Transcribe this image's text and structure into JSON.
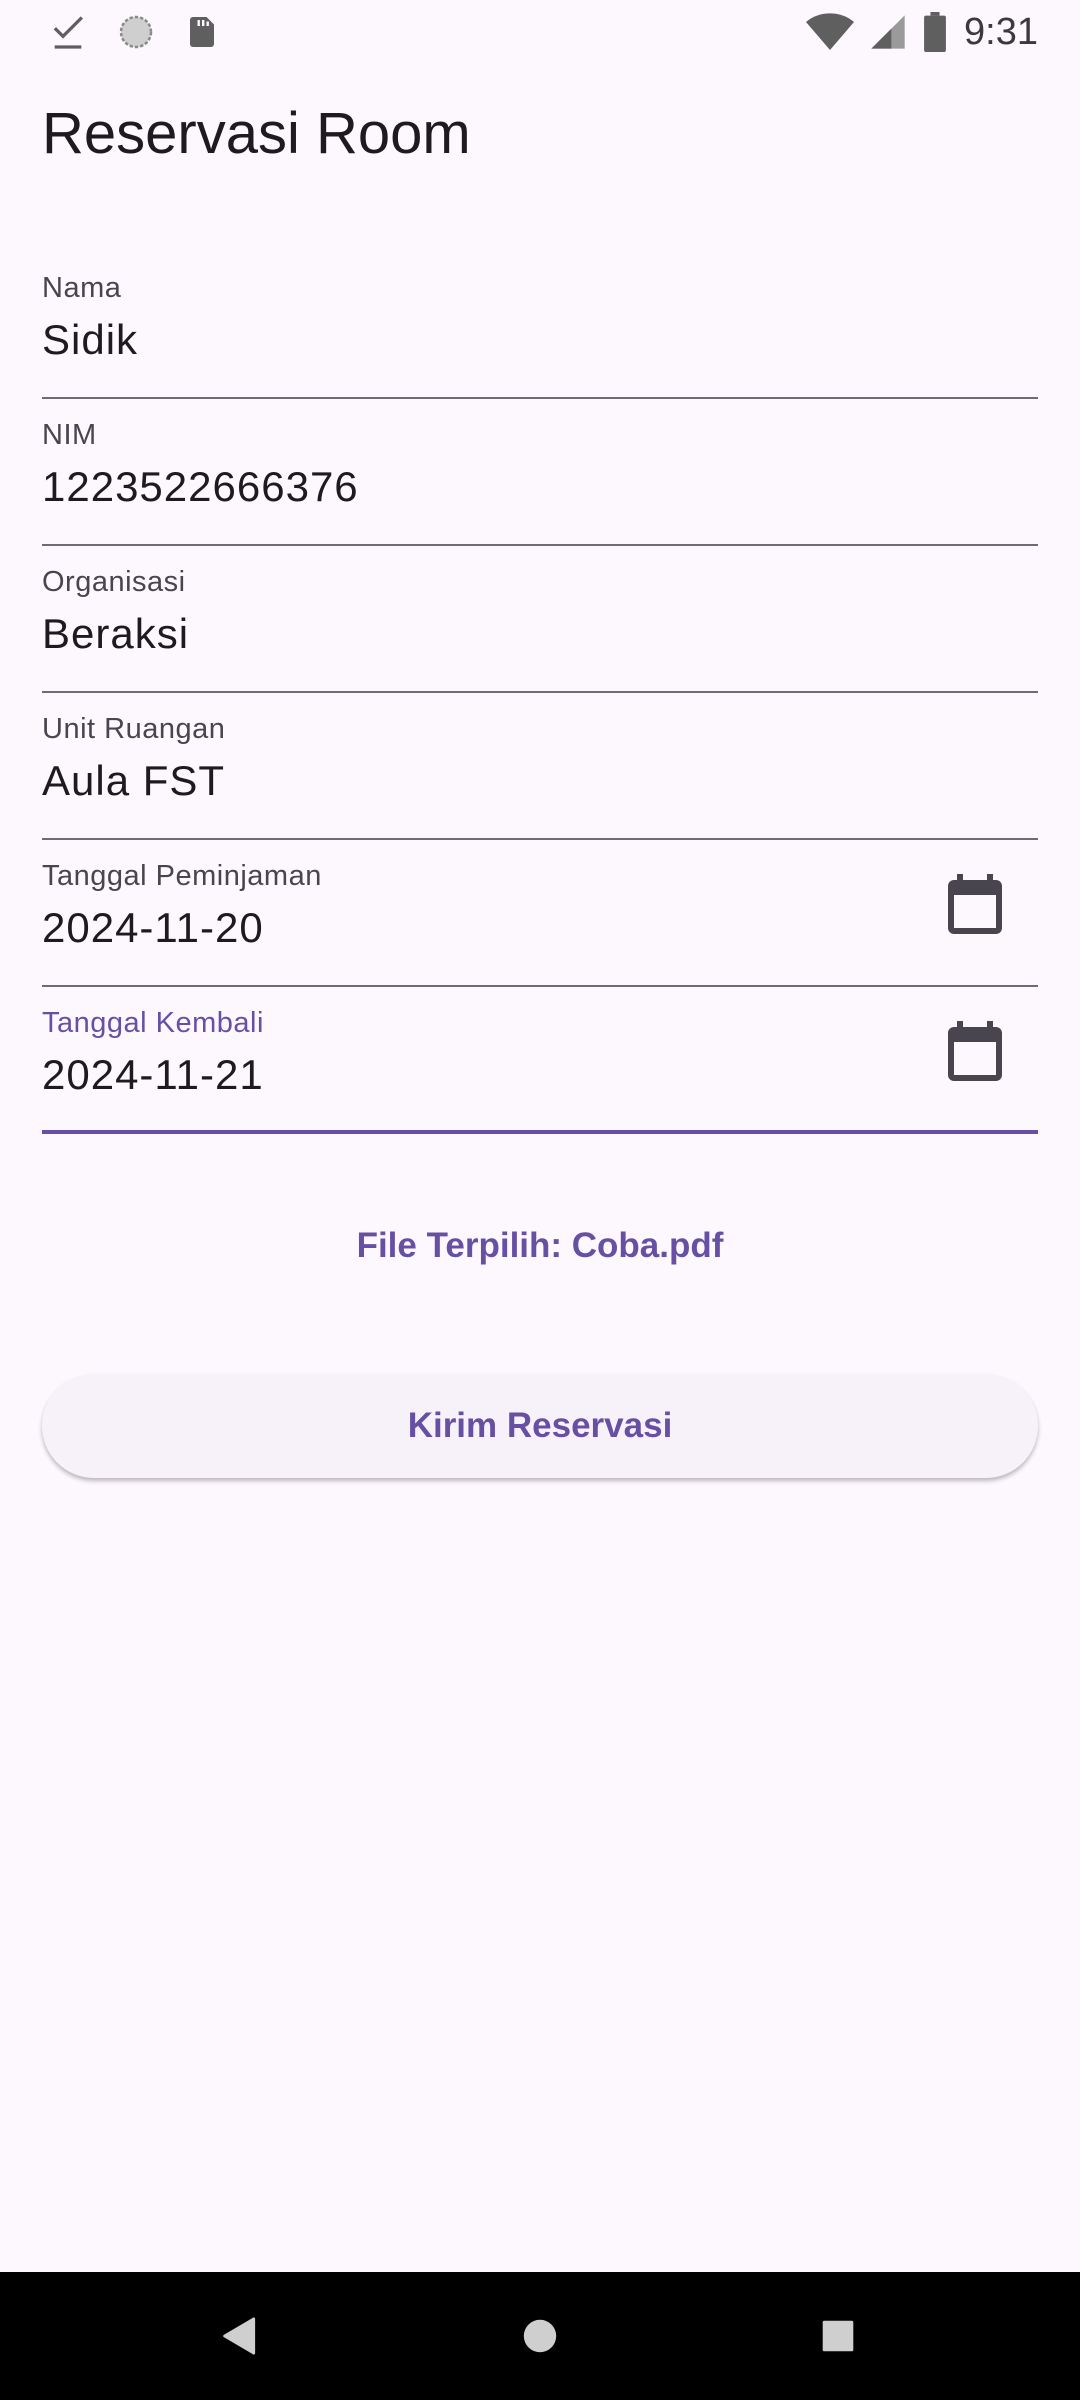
{
  "status_bar": {
    "time": "9:31",
    "left_icons": [
      "download-done-icon",
      "sync-circle-icon",
      "sd-card-icon"
    ],
    "right_icons": [
      "wifi-icon",
      "signal-icon",
      "battery-icon"
    ]
  },
  "page": {
    "title": "Reservasi Room"
  },
  "form": {
    "fields": [
      {
        "label": "Nama",
        "value": "Sidik"
      },
      {
        "label": "NIM",
        "value": "1223522666376"
      },
      {
        "label": "Organisasi",
        "value": "Beraksi"
      },
      {
        "label": "Unit Ruangan",
        "value": "Aula FST"
      },
      {
        "label": "Tanggal Peminjaman",
        "value": "2024-11-20",
        "icon": "calendar-icon"
      },
      {
        "label": "Tanggal Kembali",
        "value": "2024-11-21",
        "icon": "calendar-icon"
      }
    ],
    "file_selected": "File Terpilih: Coba.pdf",
    "submit_label": "Kirim Reservasi"
  },
  "nav_bar": {
    "buttons": [
      "back-icon",
      "home-icon",
      "recents-icon"
    ]
  },
  "colors": {
    "background": "#fdf7fe",
    "accent": "#6750a4",
    "text": "#1d1b20",
    "label": "#49454f"
  }
}
